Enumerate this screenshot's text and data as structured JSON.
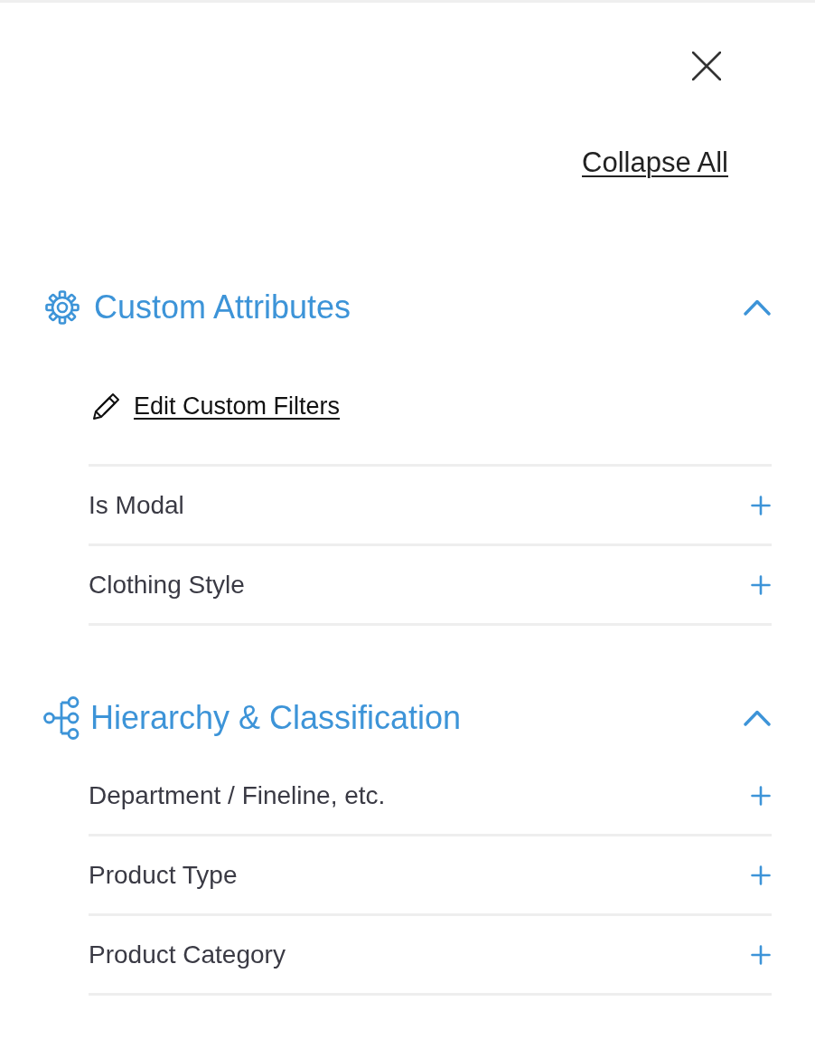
{
  "collapse_all": "Collapse All",
  "sections": [
    {
      "kind": "attributes",
      "title": "Custom Attributes",
      "expanded": true,
      "edit_link": "Edit Custom Filters",
      "filters": [
        {
          "label": "Is Modal",
          "expanded": false
        },
        {
          "label": "Clothing Style",
          "expanded": false
        }
      ]
    },
    {
      "kind": "hierarchy",
      "title": "Hierarchy & Classification",
      "expanded": true,
      "filters": [
        {
          "label": "Department / Fineline, etc.",
          "expanded": false
        },
        {
          "label": "Product Type",
          "expanded": false
        },
        {
          "label": "Product Category",
          "expanded": false
        }
      ]
    }
  ]
}
